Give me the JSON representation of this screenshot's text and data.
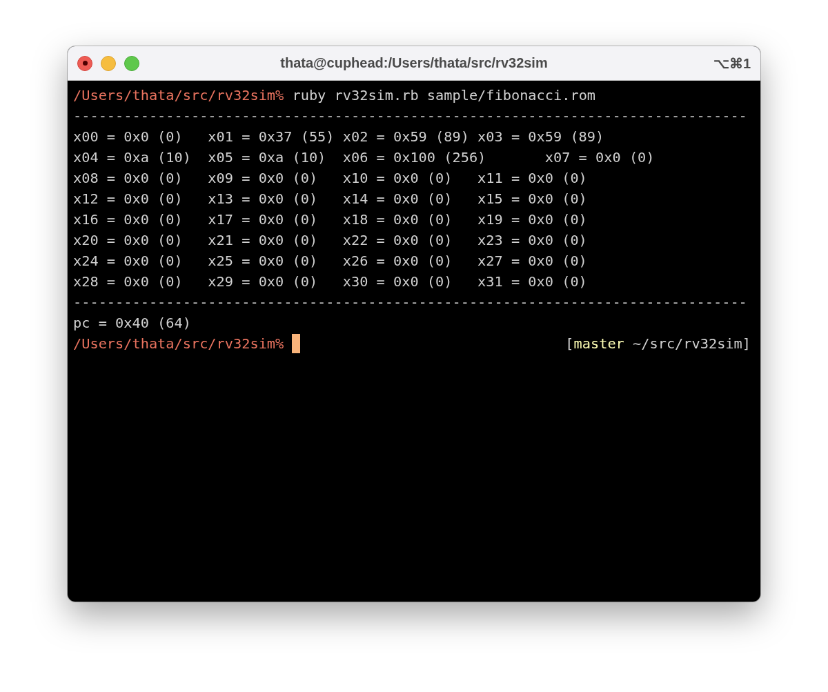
{
  "window": {
    "title": "thata@cuphead:/Users/thata/src/rv32sim",
    "shortcut": "⌥⌘1"
  },
  "lines": [
    {
      "kind": "command",
      "prompt": "/Users/thata/src/rv32sim%",
      "command": "ruby rv32sim.rb sample/fibonacci.rom"
    },
    {
      "kind": "output",
      "text": "--------------------------------------------------------------------------------"
    },
    {
      "kind": "output",
      "text": "x00 = 0x0 (0)   x01 = 0x37 (55) x02 = 0x59 (89) x03 = 0x59 (89)"
    },
    {
      "kind": "output",
      "text": "x04 = 0xa (10)  x05 = 0xa (10)  x06 = 0x100 (256)       x07 = 0x0 (0)"
    },
    {
      "kind": "output",
      "text": "x08 = 0x0 (0)   x09 = 0x0 (0)   x10 = 0x0 (0)   x11 = 0x0 (0)"
    },
    {
      "kind": "output",
      "text": "x12 = 0x0 (0)   x13 = 0x0 (0)   x14 = 0x0 (0)   x15 = 0x0 (0)"
    },
    {
      "kind": "output",
      "text": "x16 = 0x0 (0)   x17 = 0x0 (0)   x18 = 0x0 (0)   x19 = 0x0 (0)"
    },
    {
      "kind": "output",
      "text": "x20 = 0x0 (0)   x21 = 0x0 (0)   x22 = 0x0 (0)   x23 = 0x0 (0)"
    },
    {
      "kind": "output",
      "text": "x24 = 0x0 (0)   x25 = 0x0 (0)   x26 = 0x0 (0)   x27 = 0x0 (0)"
    },
    {
      "kind": "output",
      "text": "x28 = 0x0 (0)   x29 = 0x0 (0)   x30 = 0x0 (0)   x31 = 0x0 (0)"
    },
    {
      "kind": "output",
      "text": "--------------------------------------------------------------------------------"
    },
    {
      "kind": "output",
      "text": "pc = 0x40 (64)"
    },
    {
      "kind": "prompt",
      "prompt": "/Users/thata/src/rv32sim%",
      "right": {
        "open": "[",
        "branch": "master",
        "rest": "~/src/rv32sim]"
      }
    }
  ]
}
